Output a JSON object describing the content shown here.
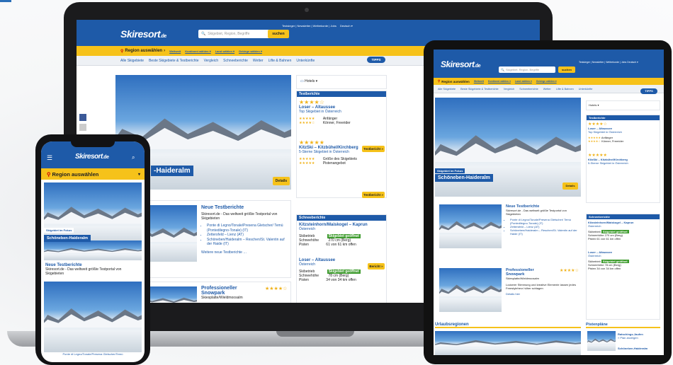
{
  "site": {
    "logo": "Skiresort",
    "logo_suffix": ".de",
    "search_placeholder": "Skigebiet, Region, Begriffe",
    "search_button": "suchen",
    "top_links": "Testsieger | Newsletter | Weltrekorde | Jobs",
    "language": "Deutsch ▾",
    "region_select": "Region auswählen",
    "region_arrow": "›",
    "region_sub": [
      "Weltweit",
      "Kontinent wählen ▾",
      "Land wählen ▾",
      "Gebirge wählen ▾"
    ],
    "menu": [
      "Alle Skigebiete",
      "Beste Skigebiete & Testberichte",
      "Vergleich",
      "Schneeberichte",
      "Wetter",
      "Lifte & Bahnen",
      "Unterkünfte"
    ],
    "tipps": "TIPPS",
    "hotels_tab": "Hotels ▾",
    "hero_label": "Skigebiet im Fokus",
    "hero_title": "Schöneben-Haideralm",
    "hero_title_partial": "-Haideralm",
    "details_btn": "Details",
    "brand_color": "#1e5aa8",
    "accent_color": "#f6c21a"
  },
  "testberichte": {
    "header": "Testberichte",
    "items": [
      {
        "stars": "★★★★☆",
        "name": "Loser – Altaussee",
        "sub": "Top Skigebiet in Österreich",
        "rows": [
          [
            "★★★★★",
            "Anfänger"
          ],
          [
            "★★★★☆",
            "Könner, Freerider"
          ]
        ]
      },
      {
        "stars": "★★★★★",
        "name": "KitzSki – Kitzbühel/Kirchberg",
        "sub": "5-Sterne Skigebiet in Österreich",
        "rows": [
          [
            "★★★★★",
            "Größe des Skigebiets"
          ],
          [
            "★★★★★",
            "Pistenangebot"
          ]
        ]
      }
    ],
    "button": "Testbericht »"
  },
  "news": {
    "title": "Neue Testberichte",
    "intro": "Skiresort.de - Das weltweit größte Testportal von Skigebieten",
    "list": [
      "Ponte di Legno/Tonale/Presena Gletscher/ Temù (Pontedilegno-Tonale) (IT)",
      "Zettersfeld – Lienz (AT)",
      "Schöneben/Haideralm – Reschen/St. Valentin auf der Haide (IT)"
    ],
    "more": "Weitere neue Testberichte …"
  },
  "snowpark": {
    "title": "Professioneller Snowpark",
    "stars": "★★★★☆",
    "sub": "Skiesplatte/Wieldmoosalm",
    "text": "Lockerer Stimmung und kreative Elemente lassen jedes Freestyleherz höher schlagen",
    "link": "Details hier"
  },
  "schneeberichte": {
    "header": "Schneeberichte",
    "items": [
      {
        "name": "Kitzsteinhorn/Maiskogel – Kaprun",
        "country": "Österreich",
        "status_label": "Skibetrieb",
        "status": "Skigebiet geöffnet",
        "depth_label": "Schneehöhe",
        "depth": "270 cm (Berg)",
        "pist_label": "Pisten",
        "pist": "61 von 61 km offen"
      },
      {
        "name": "Loser – Altaussee",
        "country": "Österreich",
        "status_label": "Skibetrieb",
        "status": "Skigebiet geöffnet",
        "depth_label": "Schneehöhe",
        "depth": "78 cm (Berg)",
        "pist_label": "Pisten",
        "pist": "34 von 34 km offen"
      }
    ],
    "button": "Bericht »"
  },
  "tablet": {
    "urlaub": "Urlaubsregionen",
    "pistenplaene": "Pistenpläne",
    "plan1": "Ratschings-Jaufen",
    "plan1_link": "» Plan anzeigen",
    "plan2": "Schöneben-Haideralm",
    "details_link": "Details hier"
  },
  "phone": {
    "news_title": "Neue Testberichte",
    "news_intro": "Skiresort.de - Das weltweit größte Testportal von Skigebieten",
    "bottom_caption": "Ponte di Legno/Tonale/Presena Gletscher/Temù",
    "menu_icon": "hamburger-icon",
    "search_icon": "search-icon"
  }
}
